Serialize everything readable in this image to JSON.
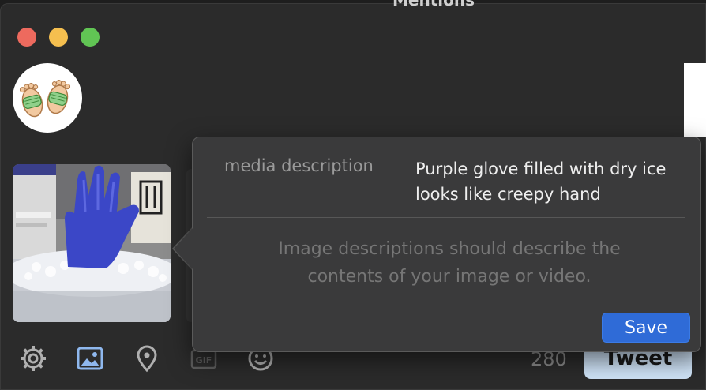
{
  "window": {
    "background_title": "Mentions"
  },
  "media_popover": {
    "label": "media description",
    "description": "Purple glove filled with dry ice looks like creepy hand",
    "hint": "Image descriptions should describe the contents of your image or video.",
    "save_label": "Save"
  },
  "composer": {
    "char_count": "280",
    "tweet_label": "Tweet",
    "gif_label": "GIF"
  },
  "toolbar_icons": [
    "gear-icon",
    "image-icon",
    "location-pin-icon",
    "gif-icon",
    "emoji-icon"
  ],
  "colors": {
    "save": "#2f6bd7",
    "tweet": "#cfe3f7",
    "popover": "#3a3a3b"
  }
}
